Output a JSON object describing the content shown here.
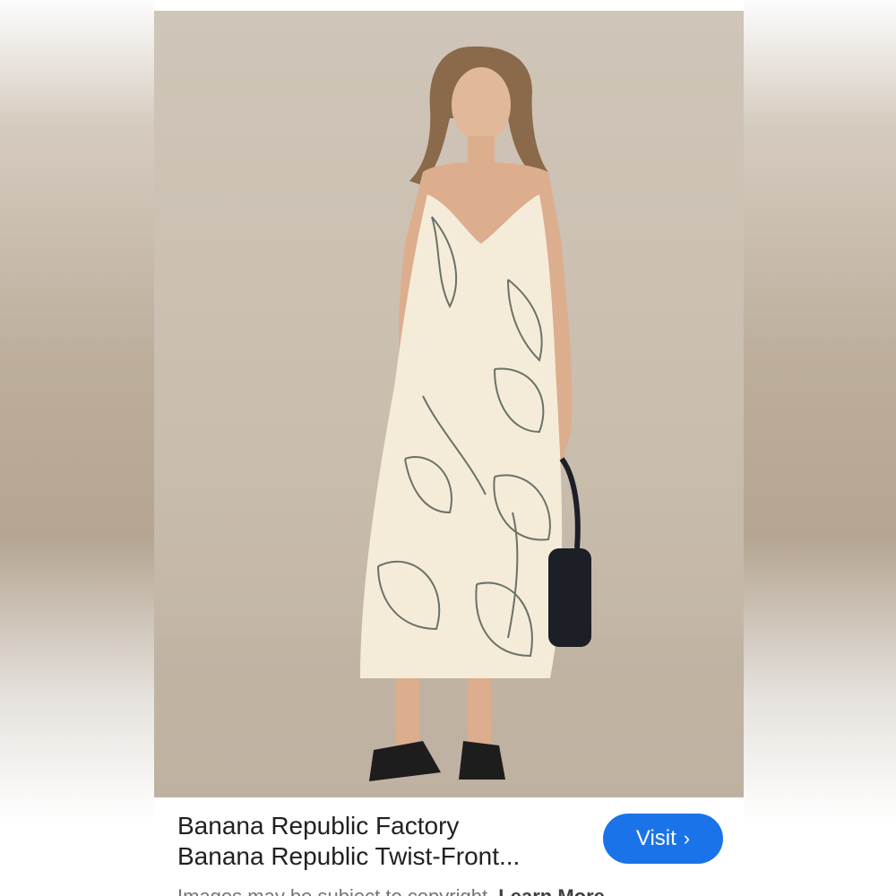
{
  "result": {
    "source": "Banana Republic Factory",
    "title": "Banana Republic Twist-Front...",
    "visit_label": "Visit",
    "visit_icon": "chevron-right-icon",
    "notice_text": "Images may be subject to copyright.",
    "learn_more_label": "Learn More"
  },
  "colors": {
    "button": "#1a73e8",
    "background": "#c9bdae",
    "dress": "#f4ecd9"
  }
}
